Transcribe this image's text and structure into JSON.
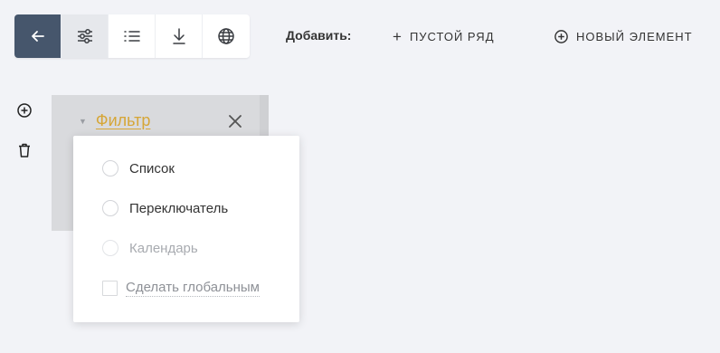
{
  "toolbar": {
    "buttons": [
      {
        "icon": "arrow-left-icon",
        "state": "back"
      },
      {
        "icon": "sliders-icon",
        "state": "active"
      },
      {
        "icon": "list-icon",
        "state": "normal"
      },
      {
        "icon": "download-icon",
        "state": "normal"
      },
      {
        "icon": "globe-icon",
        "state": "normal"
      }
    ],
    "add_label": "Добавить:",
    "empty_row": {
      "glyph": "+",
      "label": "ПУСТОЙ РЯД",
      "icon": "plus-icon"
    },
    "new_element": {
      "glyph": "⊕",
      "label": "НОВЫЙ ЭЛЕМЕНТ",
      "icon": "plus-circle-icon"
    }
  },
  "side_actions": [
    {
      "icon": "plus-circle-icon"
    },
    {
      "icon": "trash-icon"
    }
  ],
  "filter_card": {
    "caret": "▼",
    "title": "Фильтр",
    "close_glyph": "✕"
  },
  "menu": {
    "options": [
      {
        "label": "Список",
        "disabled": false
      },
      {
        "label": "Переключатель",
        "disabled": false
      },
      {
        "label": "Календарь",
        "disabled": true
      }
    ],
    "global_checkbox": {
      "label": "Сделать глобальным",
      "checked": false
    }
  },
  "colors": {
    "background": "#f2f3f7",
    "back_button": "#46566c",
    "accent_title": "#d6a637",
    "card": "#d9dadd"
  }
}
